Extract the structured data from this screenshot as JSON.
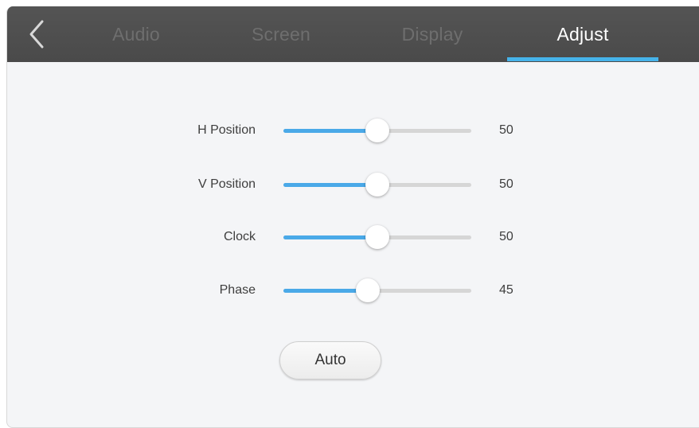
{
  "tabs": [
    {
      "label": "Audio",
      "active": false
    },
    {
      "label": "Screen",
      "active": false
    },
    {
      "label": "Display",
      "active": false
    },
    {
      "label": "Adjust",
      "active": true
    }
  ],
  "sliders": [
    {
      "label": "H Position",
      "value": "50",
      "fraction": 0.5
    },
    {
      "label": "V Position",
      "value": "50",
      "fraction": 0.5
    },
    {
      "label": "Clock",
      "value": "50",
      "fraction": 0.5
    },
    {
      "label": "Phase",
      "value": "45",
      "fraction": 0.45
    }
  ],
  "auto_button": {
    "label": "Auto"
  },
  "colors": {
    "accent": "#45b3ea",
    "slider_fill": "#4aa9e8",
    "topbar": "#4f4f4f",
    "background": "#f4f5f7"
  },
  "icons": {
    "back": "chevron-left-icon"
  }
}
